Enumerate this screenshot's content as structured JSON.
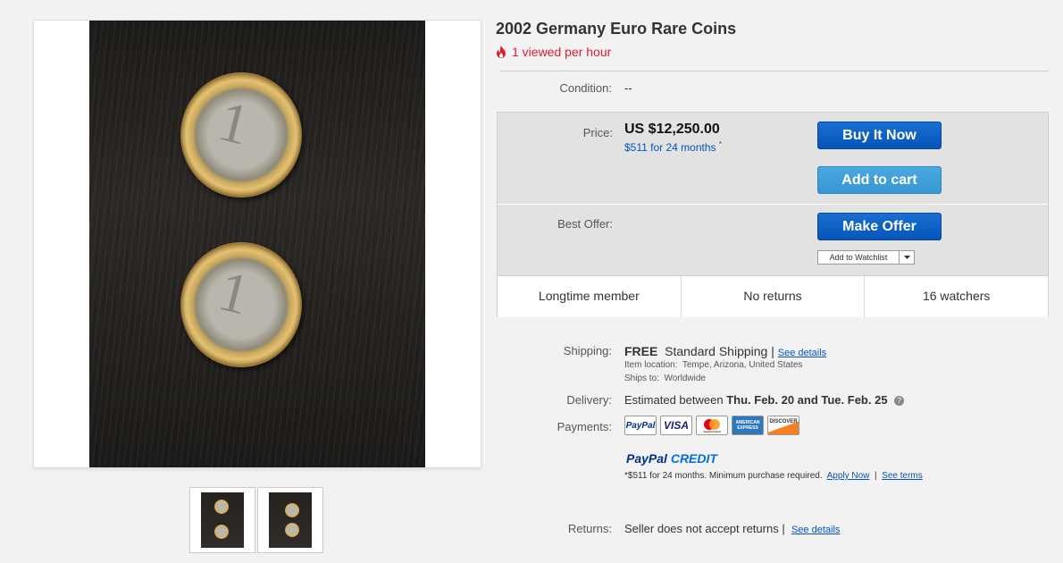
{
  "listing": {
    "title": "2002 Germany Euro Rare Coins",
    "hotness": "1 viewed per hour"
  },
  "condition": {
    "label": "Condition:",
    "value": "--"
  },
  "price": {
    "label": "Price:",
    "amount": "US $12,250.00",
    "finance": "$511 for 24 months",
    "finance_marker": "*"
  },
  "buttons": {
    "buy_now": "Buy It Now",
    "add_to_cart": "Add to cart",
    "make_offer": "Make Offer",
    "watchlist": "Add to Watchlist"
  },
  "best_offer": {
    "label": "Best Offer:"
  },
  "stats": [
    "Longtime member",
    "No returns",
    "16 watchers"
  ],
  "shipping": {
    "label": "Shipping:",
    "free": "FREE",
    "method": "Standard Shipping",
    "separator": "|",
    "details_link": "See details",
    "location_label": "Item location:",
    "location": "Tempe, Arizona, United States",
    "ships_to_label": "Ships to:",
    "ships_to": "Worldwide"
  },
  "delivery": {
    "label": "Delivery:",
    "prefix": "Estimated between",
    "dates": "Thu. Feb. 20 and Tue. Feb. 25"
  },
  "payments": {
    "label": "Payments:",
    "icons": [
      "PayPal",
      "VISA",
      "mastercard",
      "AMERICAN EXPRESS",
      "DISCOVER"
    ],
    "credit_brand_1": "PayPal",
    "credit_brand_2": "CREDIT",
    "credit_terms": "*$511 for 24 months. Minimum purchase required.",
    "apply_link": "Apply Now",
    "terms_link": "See terms",
    "separator": "|"
  },
  "returns": {
    "label": "Returns:",
    "value": "Seller does not accept returns",
    "separator": "|",
    "details_link": "See details"
  },
  "colors": {
    "accent": "#0654ba",
    "hotness": "#dd1e31",
    "buy_button": "#0654ba",
    "cart_button": "#3597d3"
  }
}
